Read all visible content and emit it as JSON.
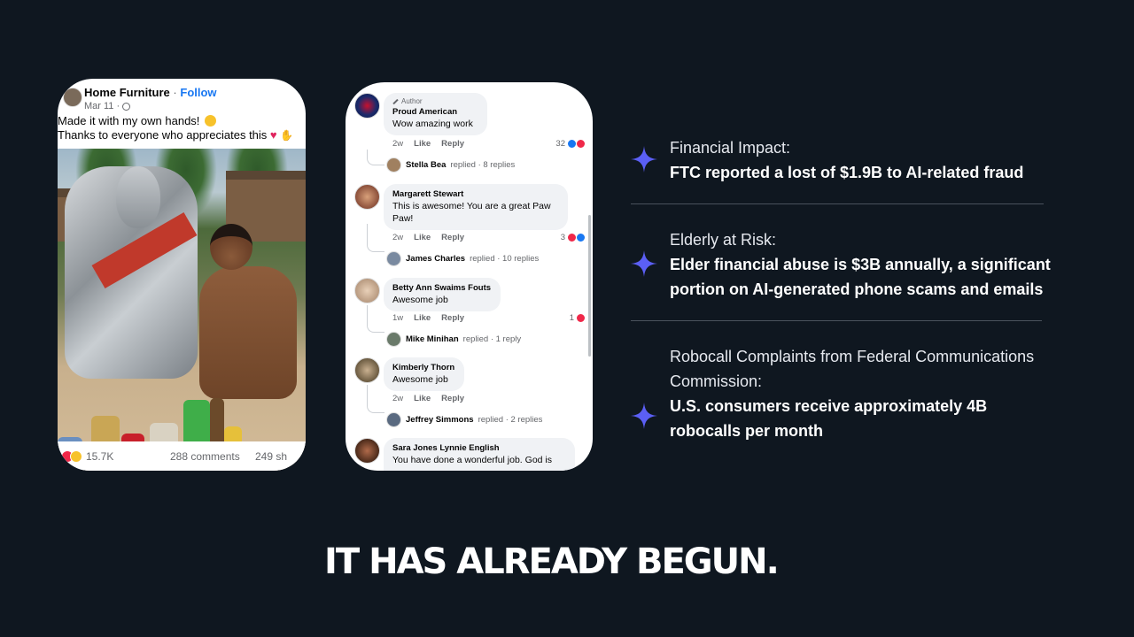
{
  "post": {
    "page_name": "Home Furniture",
    "separator": "·",
    "follow_label": "Follow",
    "date": "Mar 11 ·",
    "caption_line1": "Made it with my own hands! ",
    "caption_line2": "Thanks to everyone who appreciates this ",
    "reactions_count": "15.7K",
    "comments_count": "288 comments",
    "shares_count": "249 sh"
  },
  "comments": [
    {
      "author_tag": "Author",
      "name": "Proud American",
      "text": "Wow amazing work",
      "time": "2w",
      "like_label": "Like",
      "reply_label": "Reply",
      "reactions": "32",
      "replied_by": "Stella Bea",
      "replied_text": "replied · 8 replies"
    },
    {
      "name": "Margarett Stewart",
      "text_line1": "This is awesome! You are a great Paw",
      "text_line2": "Paw!",
      "time": "2w",
      "like_label": "Like",
      "reply_label": "Reply",
      "reactions": "3",
      "replied_by": "James Charles",
      "replied_text": "replied · 10 replies"
    },
    {
      "name": "Betty Ann Swaims Fouts",
      "text": "Awesome job",
      "time": "1w",
      "like_label": "Like",
      "reply_label": "Reply",
      "reactions": "1",
      "replied_by": "Mike Minihan",
      "replied_text": "replied · 1 reply"
    },
    {
      "name": "Kimberly Thorn",
      "text": "Awesome job",
      "time": "2w",
      "like_label": "Like",
      "reply_label": "Reply",
      "replied_by": "Jeffrey Simmons",
      "replied_text": "replied · 2 replies"
    },
    {
      "name": "Sara Jones Lynnie English",
      "text": "You have done a wonderful job.  God is"
    }
  ],
  "info": [
    {
      "heading": "Financial Impact:",
      "body_lines": [
        "FTC reported a lost of $1.9B to AI-related fraud"
      ]
    },
    {
      "heading": "Elderly at Risk:",
      "body_lines": [
        "Elder financial abuse is $3B annually, a significant",
        "portion on AI-generated phone scams and emails"
      ]
    },
    {
      "heading_lines": [
        "Robocall Complaints from Federal Communications",
        "Commission:"
      ],
      "body_lines": [
        "U.S. consumers receive approximately 4B",
        "robocalls per month"
      ]
    }
  ],
  "headline": "IT HAS ALREADY BEGUN.",
  "colors": {
    "background": "#0f1720",
    "accent_star": "#5b5ff5",
    "facebook_blue": "#1877f2",
    "love_red": "#f02849"
  }
}
